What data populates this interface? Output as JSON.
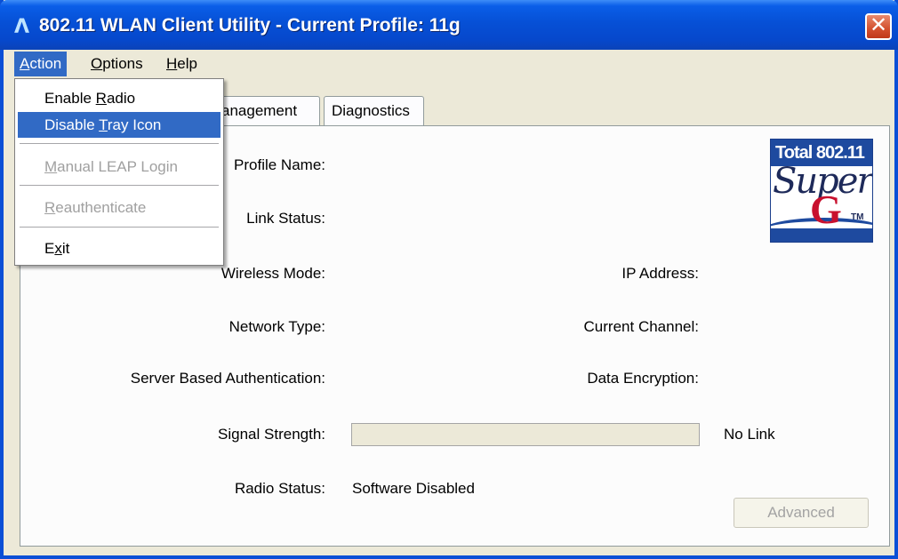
{
  "window": {
    "title": "802.11 WLAN Client Utility - Current Profile: 11g",
    "app_icon": "antenna-icon",
    "close_glyph": "✕"
  },
  "menubar": {
    "items": [
      {
        "label": "Action",
        "accel": "A",
        "rest": "ction"
      },
      {
        "label": "Options",
        "accel": "O",
        "rest": "ptions"
      },
      {
        "label": "Help",
        "accel": "H",
        "rest": "elp"
      }
    ]
  },
  "action_menu": {
    "enable_radio": {
      "pre": "Enable ",
      "accel": "R",
      "post": "adio"
    },
    "disable_tray_icon": {
      "pre": "Disable ",
      "accel": "T",
      "post": "ray Icon"
    },
    "manual_leap_login": {
      "pre": "",
      "accel": "M",
      "post": "anual LEAP Login"
    },
    "reauthenticate": {
      "pre": "",
      "accel": "R",
      "post": "eauthenticate"
    },
    "exit": {
      "pre": "E",
      "accel": "x",
      "post": "it"
    }
  },
  "tabs": {
    "management": "anagement",
    "diagnostics": "Diagnostics"
  },
  "status": {
    "profile_name_label": "Profile Name:",
    "link_status_label": "Link Status:",
    "wireless_mode_label": "Wireless Mode:",
    "ip_address_label": "IP Address:",
    "network_type_label": "Network Type:",
    "current_channel_label": "Current Channel:",
    "server_auth_label": "Server Based Authentication:",
    "data_encryption_label": "Data Encryption:",
    "signal_strength_label": "Signal Strength:",
    "signal_strength_value": "No Link",
    "signal_strength_level": 0,
    "radio_status_label": "Radio Status:",
    "radio_status_value": "Software Disabled",
    "advanced_button": "Advanced"
  },
  "logo": {
    "line1": "Total 802.11",
    "line2": "Super",
    "line3": "G",
    "tm": "TM"
  },
  "colors": {
    "titlebar": "#0650d6",
    "menu_highlight": "#316ac5",
    "logo_blue": "#1e4a9f",
    "logo_red": "#c8102e"
  }
}
